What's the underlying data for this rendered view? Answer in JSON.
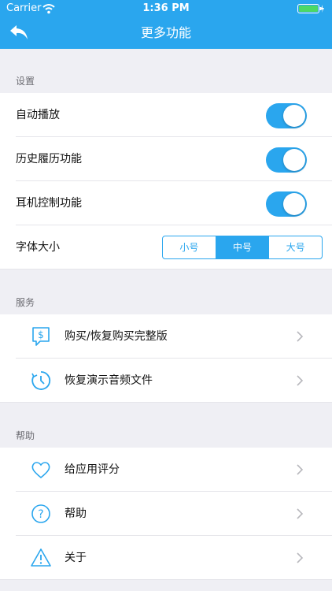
{
  "status": {
    "carrier": "Carrier",
    "time": "1:36 PM"
  },
  "nav": {
    "title": "更多功能"
  },
  "settings": {
    "header": "设置",
    "rows": [
      {
        "label": "自动播放",
        "on": true
      },
      {
        "label": "历史履历功能",
        "on": true
      },
      {
        "label": "耳机控制功能",
        "on": true
      }
    ],
    "font_size": {
      "label": "字体大小",
      "options": [
        "小号",
        "中号",
        "大号"
      ],
      "selected": "中号"
    }
  },
  "service": {
    "header": "服务",
    "items": [
      {
        "label": "购买/恢复购买完整版",
        "icon": "dollar-chat-icon"
      },
      {
        "label": "恢复演示音频文件",
        "icon": "restore-clock-icon"
      }
    ]
  },
  "help": {
    "header": "帮助",
    "items": [
      {
        "label": "给应用评分",
        "icon": "heart-icon"
      },
      {
        "label": "帮助",
        "icon": "question-icon"
      },
      {
        "label": "关于",
        "icon": "warning-icon"
      }
    ]
  },
  "colors": {
    "accent": "#2aa6ee",
    "background": "#efeff4"
  }
}
